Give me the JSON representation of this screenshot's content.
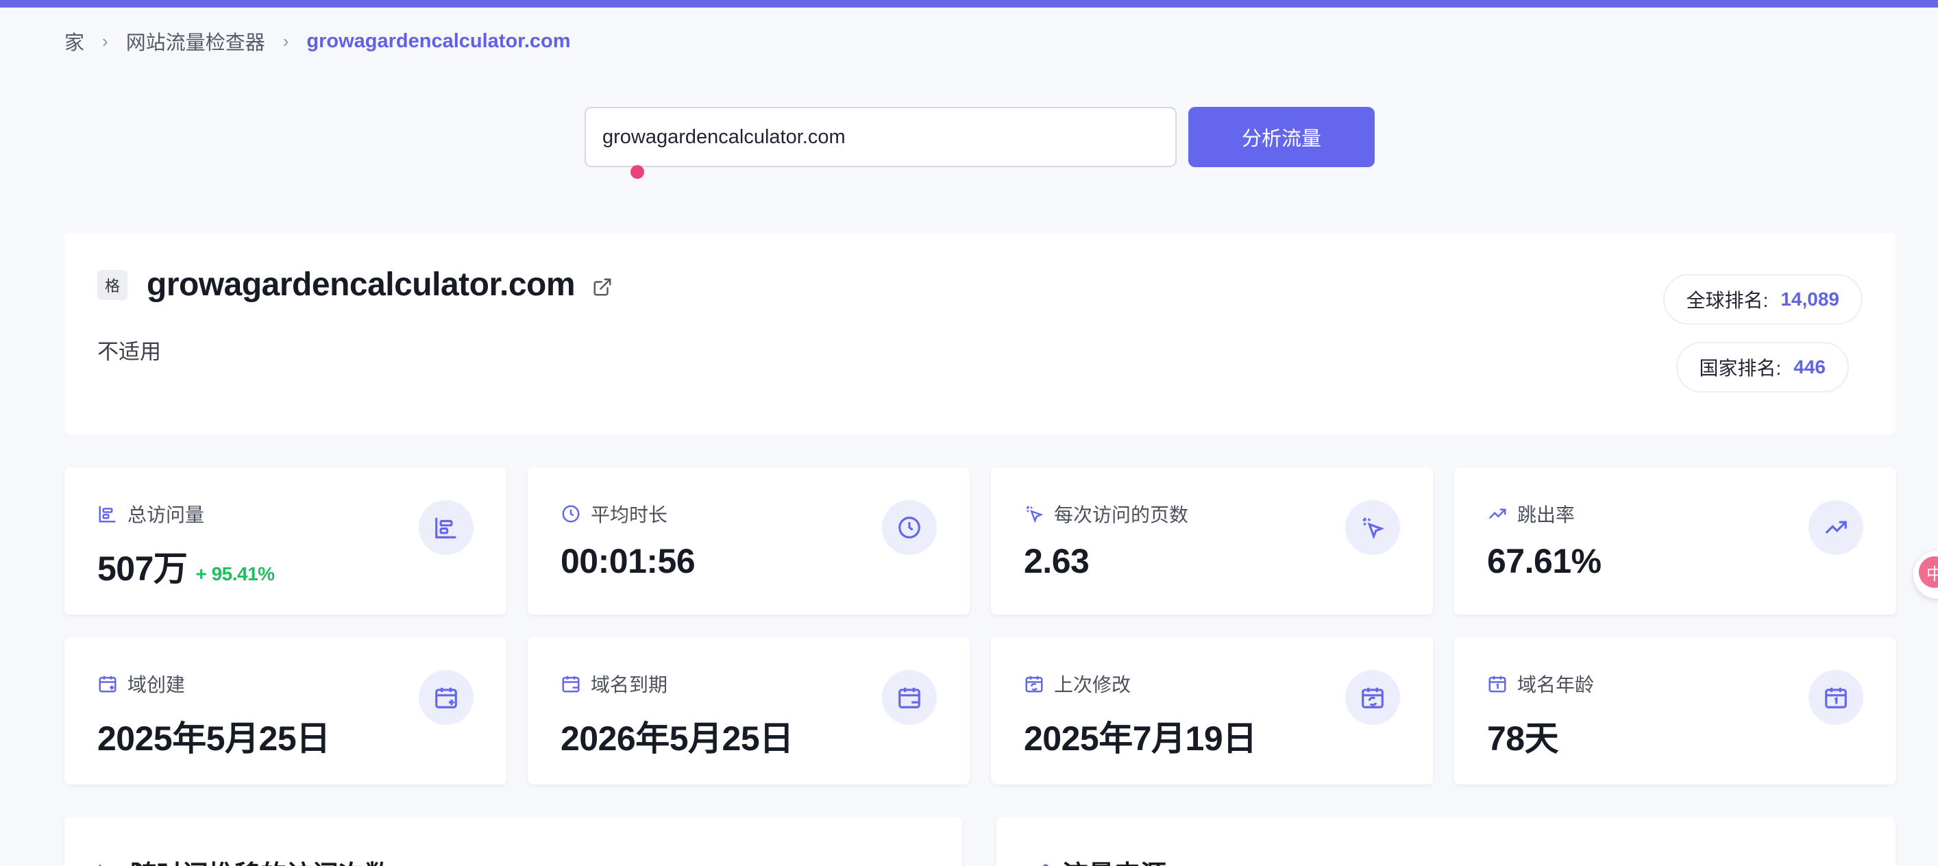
{
  "breadcrumb": {
    "home": "家",
    "tool": "网站流量检查器",
    "current": "growagardencalculator.com"
  },
  "search": {
    "value": "growagardencalculator.com",
    "button_label": "分析流量"
  },
  "site": {
    "favicon_char": "格",
    "name": "growagardencalculator.com",
    "description": "不适用",
    "global_rank_label": "全球排名:",
    "global_rank_value": "14,089",
    "country_rank_label": "国家排名:",
    "country_rank_value": "446"
  },
  "stats": [
    {
      "label": "总访问量",
      "value": "507万",
      "change": "+ 95.41%",
      "icon": "bar-chart-icon"
    },
    {
      "label": "平均时长",
      "value": "00:01:56",
      "icon": "clock-icon"
    },
    {
      "label": "每次访问的页数",
      "value": "2.63",
      "icon": "click-pointer-icon"
    },
    {
      "label": "跳出率",
      "value": "67.61%",
      "icon": "trending-up-icon"
    },
    {
      "label": "域创建",
      "value": "2025年5月25日",
      "icon": "calendar-plus-icon"
    },
    {
      "label": "域名到期",
      "value": "2026年5月25日",
      "icon": "calendar-minus-icon"
    },
    {
      "label": "上次修改",
      "value": "2025年7月19日",
      "icon": "calendar-sync-icon"
    },
    {
      "label": "域名年龄",
      "value": "78天",
      "icon": "calendar-day-icon"
    }
  ],
  "sections": {
    "visits_trend_title": "随时间推移的访问次数",
    "traffic_sources_title": "流量来源"
  },
  "floating_badge": "中",
  "colors": {
    "accent": "#6466ec",
    "positive": "#1fbf5c",
    "top_bar": "#6767ec",
    "background": "#f7f8fb"
  }
}
